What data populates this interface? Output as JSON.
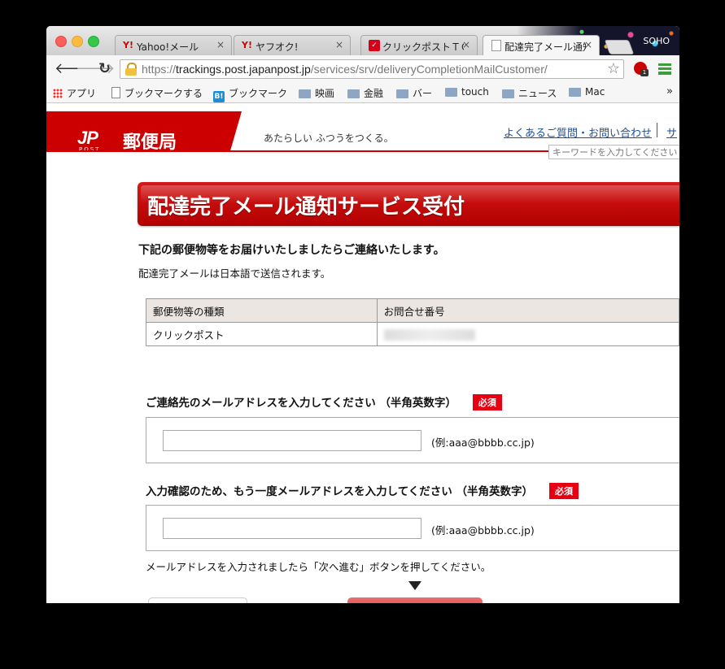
{
  "browser": {
    "tabs": [
      {
        "label": "Yahoo!メール",
        "favicon": "Y!",
        "close": "×"
      },
      {
        "label": "ヤフオク!",
        "favicon": "Y!",
        "close": "×"
      },
      {
        "label": "クリックポストＴＯ",
        "favicon": "",
        "close": "×"
      },
      {
        "label": "配達完了メール通知",
        "favicon": "",
        "close": "×"
      }
    ],
    "profile_name": "SOHO",
    "url_scheme": "https://",
    "url_host": "trackings.post.japanpost.jp",
    "url_path": "/services/srv/deliveryCompletionMailCustomer/",
    "extension_badge": "1",
    "bookmarks": [
      {
        "label": "アプリ",
        "icon": "apps-icon"
      },
      {
        "label": "ブックマークする",
        "icon": "page-icon"
      },
      {
        "label": "ブックマーク",
        "icon": "hatena-icon",
        "icon_text": "B!"
      },
      {
        "label": "映画",
        "icon": "folder-icon"
      },
      {
        "label": "金融",
        "icon": "folder-icon"
      },
      {
        "label": "バー",
        "icon": "folder-icon"
      },
      {
        "label": "touch",
        "icon": "folder-icon"
      },
      {
        "label": "ニュース",
        "icon": "folder-icon"
      },
      {
        "label": "Mac",
        "icon": "folder-icon"
      }
    ],
    "bookmarks_more": "»"
  },
  "site": {
    "logo_mark": "JP",
    "logo_post": "POST",
    "logo_name": "郵便局",
    "tagline": "あたらしい ふつうをつくる。",
    "faq_link": "よくあるご質問・お問い合わせ",
    "cut_link": "サ",
    "search_placeholder": "キーワードを入力してください",
    "brand_color": "#cc0000"
  },
  "main": {
    "heading": "配達完了メール通知サービス受付",
    "lead": "下記の郵便物等をお届けいたしましたらご連絡いたします。",
    "sub": "配達完了メールは日本語で送信されます。",
    "table": {
      "headers": [
        "郵便物等の種類",
        "お問合せ番号"
      ],
      "rows": [
        [
          "クリックポスト",
          ""
        ]
      ]
    },
    "email_label": "ご連絡先のメールアドレスを入力してください （半角英数字）",
    "email_confirm_label": "入力確認のため、もう一度メールアドレスを入力してください （半角英数字）",
    "required_badge": "必須",
    "email_hint": "(例:aaa@bbbb.cc.jp)",
    "instruction": "メールアドレスを入力されましたら「次へ進む」ボタンを押してください。"
  }
}
